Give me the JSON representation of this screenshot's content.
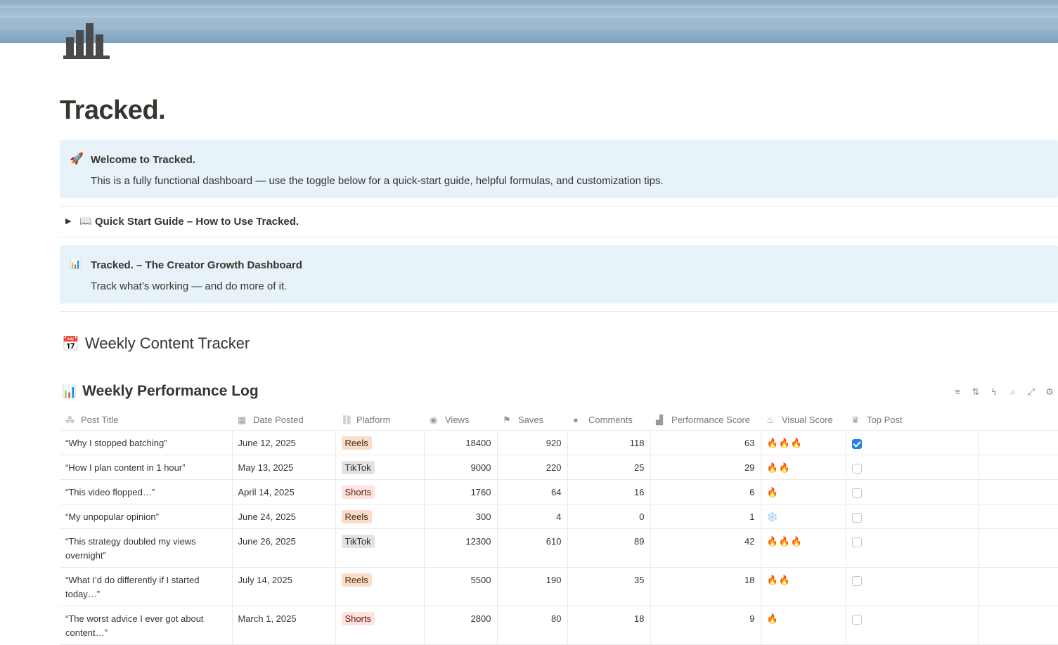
{
  "page": {
    "title": "Tracked.",
    "icon": "bar-chart-icon"
  },
  "callout_welcome": {
    "emoji": "🚀",
    "title": "Welcome to Tracked.",
    "body": "This is a fully functional dashboard — use the toggle below for a quick-start guide, helpful formulas, and customization tips."
  },
  "toggle_quickstart": {
    "emoji": "📖",
    "label": "Quick Start Guide – How to Use Tracked."
  },
  "callout_dashboard": {
    "emoji": "📊",
    "title": "Tracked. – The Creator Growth Dashboard",
    "body": "Track what’s working — and do more of it."
  },
  "section_heading": {
    "emoji": "📅",
    "label": "Weekly Content Tracker"
  },
  "database": {
    "emoji": "📊",
    "title": "Weekly Performance Log",
    "toolbar": [
      "filter-icon",
      "sort-icon",
      "automation-icon",
      "search-icon",
      "expand-icon",
      "settings-icon"
    ],
    "columns": [
      {
        "label": "Post Title",
        "icon": "title-icon",
        "glyph": "⁂"
      },
      {
        "label": "Date Posted",
        "icon": "calendar-icon",
        "glyph": "▦"
      },
      {
        "label": "Platform",
        "icon": "link-icon",
        "glyph": "⛓"
      },
      {
        "label": "Views",
        "icon": "eye-icon",
        "glyph": "◉"
      },
      {
        "label": "Saves",
        "icon": "bookmark-icon",
        "glyph": "⚑"
      },
      {
        "label": "Comments",
        "icon": "comment-icon",
        "glyph": "●"
      },
      {
        "label": "Performance Score",
        "icon": "chart-icon",
        "glyph": "▟"
      },
      {
        "label": "Visual Score",
        "icon": "flame-icon",
        "glyph": "♨"
      },
      {
        "label": "Top Post",
        "icon": "trophy-icon",
        "glyph": "♛"
      }
    ],
    "rows": [
      {
        "title": "“Why I stopped batching”",
        "date": "June 12, 2025",
        "platform": "Reels",
        "views": "18400",
        "saves": "920",
        "comments": "118",
        "score": "63",
        "visual": "🔥🔥🔥",
        "top": true
      },
      {
        "title": "“How I plan content in 1 hour”",
        "date": "May 13, 2025",
        "platform": "TikTok",
        "views": "9000",
        "saves": "220",
        "comments": "25",
        "score": "29",
        "visual": "🔥🔥",
        "top": false
      },
      {
        "title": "“This video flopped…”",
        "date": "April 14, 2025",
        "platform": "Shorts",
        "views": "1760",
        "saves": "64",
        "comments": "16",
        "score": "6",
        "visual": "🔥",
        "top": false
      },
      {
        "title": "“My unpopular opinion”",
        "date": "June 24, 2025",
        "platform": "Reels",
        "views": "300",
        "saves": "4",
        "comments": "0",
        "score": "1",
        "visual": "❄️",
        "top": false
      },
      {
        "title": "“This strategy doubled my views overnight”",
        "date": "June 26, 2025",
        "platform": "TikTok",
        "views": "12300",
        "saves": "610",
        "comments": "89",
        "score": "42",
        "visual": "🔥🔥🔥",
        "top": false
      },
      {
        "title": "“What I’d do differently if I started today…”",
        "date": "July 14, 2025",
        "platform": "Reels",
        "views": "5500",
        "saves": "190",
        "comments": "35",
        "score": "18",
        "visual": "🔥🔥",
        "top": false
      },
      {
        "title": "“The worst advice I ever got about content…”",
        "date": "March 1, 2025",
        "platform": "Shorts",
        "views": "2800",
        "saves": "80",
        "comments": "18",
        "score": "9",
        "visual": "🔥",
        "top": false
      }
    ]
  }
}
